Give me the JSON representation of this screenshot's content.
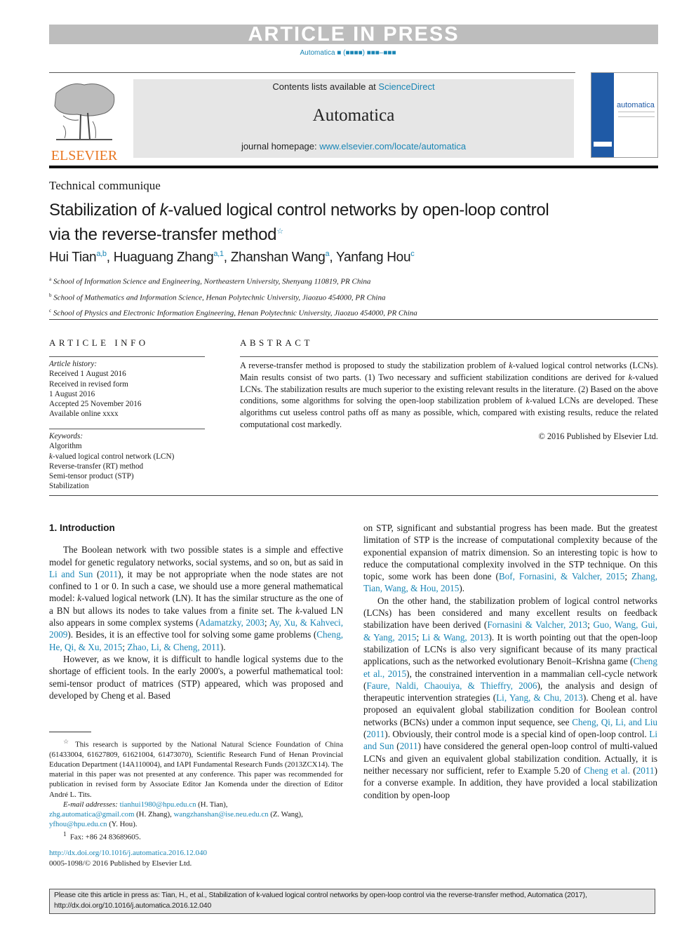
{
  "banner": {
    "text": "ARTICLE IN PRESS"
  },
  "journal_ref": {
    "journal": "Automatica",
    "placeholder": "■ (■■■■) ■■■–■■■"
  },
  "masthead": {
    "contents_prefix": "Contents lists available at ",
    "contents_link": "ScienceDirect",
    "journal_title": "Automatica",
    "homepage_prefix": "journal homepage: ",
    "homepage_link": "www.elsevier.com/locate/automatica"
  },
  "publisher_logo": {
    "word": "ELSEVIER",
    "icon": "tree-icon"
  },
  "cover": {
    "title": "automatica"
  },
  "article": {
    "section_type": "Technical communique",
    "title_part1": "Stabilization of ",
    "title_k": "k",
    "title_part2": "-valued logical control networks by open-loop control via the reverse-transfer method",
    "title_mark": "☆",
    "authors": [
      {
        "name": "Hui Tian",
        "sup": "a,b"
      },
      {
        "name": "Huaguang Zhang",
        "sup": "a,1"
      },
      {
        "name": "Zhanshan Wang",
        "sup": "a"
      },
      {
        "name": "Yanfang Hou",
        "sup": "c"
      }
    ],
    "affiliations": [
      {
        "sup": "a",
        "text": "School of Information Science and Engineering, Northeastern University, Shenyang 110819, PR China"
      },
      {
        "sup": "b",
        "text": "School of Mathematics and Information Science, Henan Polytechnic University, Jiaozuo 454000, PR China"
      },
      {
        "sup": "c",
        "text": "School of Physics and Electronic Information Engineering, Henan Polytechnic University, Jiaozuo 454000, PR China"
      }
    ]
  },
  "article_info": {
    "heading": "ARTICLE INFO",
    "history_label": "Article history:",
    "history": [
      "Received 1 August 2016",
      "Received in revised form",
      "1 August 2016",
      "Accepted 25 November 2016",
      "Available online xxxx"
    ],
    "keywords_label": "Keywords:",
    "keywords": [
      "Algorithm",
      "k-valued logical control network (LCN)",
      "Reverse-transfer (RT) method",
      "Semi-tensor product (STP)",
      "Stabilization"
    ]
  },
  "abstract": {
    "heading": "ABSTRACT",
    "text": "A reverse-transfer method is proposed to study the stabilization problem of k-valued logical control networks (LCNs). Main results consist of two parts. (1) Two necessary and sufficient stabilization conditions are derived for k-valued LCNs. The stabilization results are much superior to the existing relevant results in the literature. (2) Based on the above conditions, some algorithms for solving the open-loop stabilization problem of k-valued LCNs are developed. These algorithms cut useless control paths off as many as possible, which, compared with existing results, reduce the related computational cost markedly.",
    "copyright": "© 2016 Published by Elsevier Ltd."
  },
  "introduction": {
    "heading": "1. Introduction",
    "left_p1": [
      {
        "t": "The Boolean network with two possible states is a simple and effective model for genetic regulatory networks, social systems, and so on, but as said in "
      },
      {
        "l": "Li and Sun"
      },
      {
        "t": " ("
      },
      {
        "l": "2011"
      },
      {
        "t": "), it may be not appropriate when the node states are not confined to 1 or 0. In such a case, we should use a more general mathematical model: "
      },
      {
        "i": "k"
      },
      {
        "t": "-valued logical network (LN). It has the similar structure as the one of a BN but allows its nodes to take values from a finite set. The "
      },
      {
        "i": "k"
      },
      {
        "t": "-valued LN also appears in some complex systems ("
      },
      {
        "l": "Adamatzky, 2003"
      },
      {
        "t": "; "
      },
      {
        "l": "Ay, Xu, & Kahveci, 2009"
      },
      {
        "t": "). Besides, it is an effective tool for solving some game problems ("
      },
      {
        "l": "Cheng, He, Qi, & Xu, 2015"
      },
      {
        "t": "; "
      },
      {
        "l": "Zhao, Li, & Cheng, 2011"
      },
      {
        "t": ")."
      }
    ],
    "left_p2": [
      {
        "t": "However, as we know, it is difficult to handle logical systems due to the shortage of efficient tools. In the early 2000's, a powerful mathematical tool: semi-tensor product of matrices (STP) appeared, which was proposed and developed by Cheng et al. Based"
      }
    ],
    "right_p1": [
      {
        "t": "on STP, significant and substantial progress has been made. But the greatest limitation of STP is the increase of computational complexity because of the exponential expansion of matrix dimension. So an interesting topic is how to reduce the computational complexity involved in the STP technique. On this topic, some work has been done ("
      },
      {
        "l": "Bof, Fornasini, & Valcher, 2015"
      },
      {
        "t": "; "
      },
      {
        "l": "Zhang, Tian, Wang, & Hou, 2015"
      },
      {
        "t": ")."
      }
    ],
    "right_p2": [
      {
        "t": "On the other hand, the stabilization problem of logical control networks (LCNs) has been considered and many excellent results on feedback stabilization have been derived ("
      },
      {
        "l": "Fornasini & Valcher, 2013"
      },
      {
        "t": "; "
      },
      {
        "l": "Guo, Wang, Gui, & Yang, 2015"
      },
      {
        "t": "; "
      },
      {
        "l": "Li & Wang, 2013"
      },
      {
        "t": "). It is worth pointing out that the open-loop stabilization of LCNs is also very significant because of its many practical applications, such as the networked evolutionary Benoit–Krishna game ("
      },
      {
        "l": "Cheng et al., 2015"
      },
      {
        "t": "), the constrained intervention in a mammalian cell-cycle network ("
      },
      {
        "l": "Faure, Naldi, Chaouiya, & Thieffry, 2006"
      },
      {
        "t": "), the analysis and design of therapeutic intervention strategies ("
      },
      {
        "l": "Li, Yang, & Chu, 2013"
      },
      {
        "t": "). Cheng et al. have proposed an equivalent global stabilization condition for Boolean control networks (BCNs) under a common input sequence, see "
      },
      {
        "l": "Cheng, Qi, Li, and Liu"
      },
      {
        "t": " ("
      },
      {
        "l": "2011"
      },
      {
        "t": "). Obviously, their control mode is a special kind of open-loop control. "
      },
      {
        "l": "Li and Sun"
      },
      {
        "t": " ("
      },
      {
        "l": "2011"
      },
      {
        "t": ") have considered the general open-loop control of multi-valued LCNs and given an equivalent global stabilization condition. Actually, it is neither necessary nor sufficient, refer to Example 5.20 of "
      },
      {
        "l": "Cheng et al."
      },
      {
        "t": " ("
      },
      {
        "l": "2011"
      },
      {
        "t": ") for a converse example. In addition, they have provided a local stabilization condition by open-loop"
      }
    ]
  },
  "footnotes": {
    "star_mark": "☆",
    "star_text": "This research is supported by the National Natural Science Foundation of China (61433004, 61627809, 61621004, 61473070), Scientific Research Fund of Henan Provincial Education Department (14A110004), and IAPI Fundamental Research Funds (2013ZCX14). The material in this paper was not presented at any conference. This paper was recommended for publication in revised form by Associate Editor Jan Komenda under the direction of Editor André L. Tits.",
    "email_label": "E-mail addresses:",
    "emails": [
      {
        "addr": "tianhui1980@hpu.edu.cn",
        "who": " (H. Tian),"
      },
      {
        "addr": "zhg.automatica@gmail.com",
        "who": " (H. Zhang), "
      },
      {
        "addr": "wangzhanshan@ise.neu.edu.cn",
        "who": " (Z. Wang),"
      },
      {
        "addr": "yfhou@hpu.edu.cn",
        "who": " (Y. Hou)."
      }
    ],
    "fax_mark": "1",
    "fax_text": "Fax: +86 24 83689605."
  },
  "doi": {
    "link": "http://dx.doi.org/10.1016/j.automatica.2016.12.040",
    "issn": "0005-1098/© 2016 Published by Elsevier Ltd."
  },
  "cite_box": {
    "text": "Please cite this article in press as: Tian, H., et al., Stabilization of k-valued logical control networks by open-loop control via the reverse-transfer method, Automatica (2017), http://dx.doi.org/10.1016/j.automatica.2016.12.040"
  },
  "colors": {
    "link": "#1a86b5",
    "elsevier_orange": "#e87722",
    "banner_gray": "#bdbdbd",
    "masthead_gray": "#e6e6e6"
  }
}
